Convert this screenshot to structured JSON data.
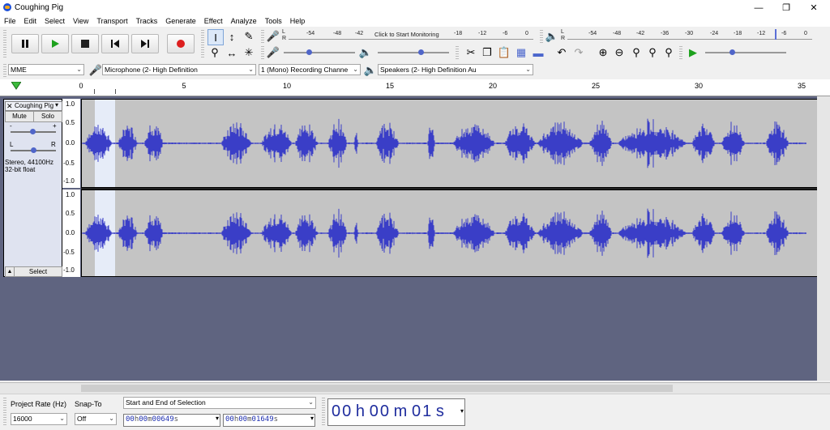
{
  "window": {
    "title": "Coughing Pig"
  },
  "menu": [
    "File",
    "Edit",
    "Select",
    "View",
    "Transport",
    "Tracks",
    "Generate",
    "Effect",
    "Analyze",
    "Tools",
    "Help"
  ],
  "transport": {
    "pause": "pause-icon",
    "play": "play-icon",
    "stop": "stop-icon",
    "skip_start": "skip-start-icon",
    "skip_end": "skip-end-icon",
    "record": "record-icon"
  },
  "record_meter": {
    "ticks": [
      "-54",
      "-48",
      "-42",
      "-18",
      "-12",
      "-6",
      "0"
    ],
    "monitor_text": "Click to Start Monitoring",
    "lr": [
      "L",
      "R"
    ]
  },
  "playback_meter": {
    "ticks": [
      "-54",
      "-48",
      "-42",
      "-36",
      "-30",
      "-24",
      "-18",
      "-12",
      "-6",
      "0"
    ]
  },
  "device": {
    "host": "MME",
    "mic": "Microphone (2- High Definition",
    "channels": "1 (Mono) Recording Channe",
    "speakers": "Speakers (2- High Definition Au"
  },
  "ruler": {
    "ticks": [
      "0",
      "5",
      "10",
      "15",
      "20",
      "25",
      "30",
      "35"
    ]
  },
  "track": {
    "name": "Coughing Pig",
    "mute": "Mute",
    "solo": "Solo",
    "gain_minus": "-",
    "gain_plus": "+",
    "pan_l": "L",
    "pan_r": "R",
    "info1": "Stereo, 44100Hz",
    "info2": "32-bit float",
    "select": "Select",
    "scale": [
      "1.0",
      "0.5",
      "0.0",
      "-0.5",
      "-1.0"
    ]
  },
  "bottom": {
    "project_rate_label": "Project Rate (Hz)",
    "project_rate": "16000",
    "snap_label": "Snap-To",
    "snap": "Off",
    "selection_mode": "Start and End of Selection",
    "sel_start": [
      "00",
      "h",
      "00",
      "m",
      "00",
      "649",
      "s"
    ],
    "sel_end": [
      "00",
      "h",
      "00",
      "m",
      "01",
      "649",
      "s"
    ],
    "audio_pos": [
      "00",
      "h",
      "00",
      "m",
      "01",
      "s"
    ]
  }
}
